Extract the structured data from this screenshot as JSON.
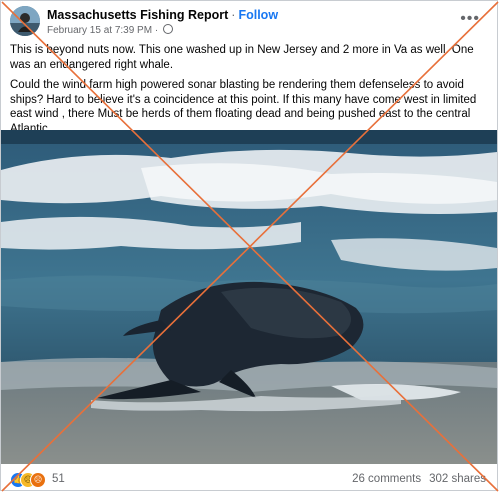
{
  "post": {
    "author": "Massachusetts Fishing Report",
    "follow_label": "Follow",
    "separator": "·",
    "timestamp": "February 15 at 7:39 PM",
    "meta_separator": "·",
    "more_icon": "more-horizontal-icon",
    "paragraphs": [
      "This is beyond nuts now.  This one washed up in New Jersey and 2 more in Va as well.  One was an endangered right whale.",
      "Could the wind farm high powered sonar blasting be rendering them defenseless to avoid ships?  Hard to believe it's a coincidence at this point.   If this many have come west in limited east wind , there Must be herds of them floating dead and being pushed east to the central Atlantic"
    ]
  },
  "footer": {
    "reactions": [
      "like-icon",
      "sad-icon",
      "angry-icon"
    ],
    "reaction_count": "51",
    "comments": "26 comments",
    "shares": "302 shares"
  },
  "colors": {
    "accent": "#1877f2",
    "overlay_x": "#e8703a"
  }
}
